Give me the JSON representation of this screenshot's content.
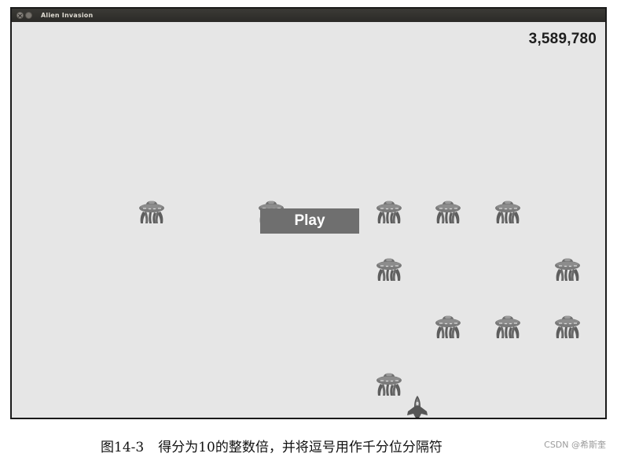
{
  "window": {
    "title": "Alien Invasion"
  },
  "game": {
    "score": "3,589,780",
    "play_button_label": "Play",
    "alien_icon": "alien-ufo-icon",
    "ship_icon": "rocket-ship-icon"
  },
  "caption": {
    "figure_number": "图14-3",
    "text": "得分为10的整数倍，并将逗号用作千分位分隔符"
  },
  "watermark": "CSDN @希斯奎"
}
